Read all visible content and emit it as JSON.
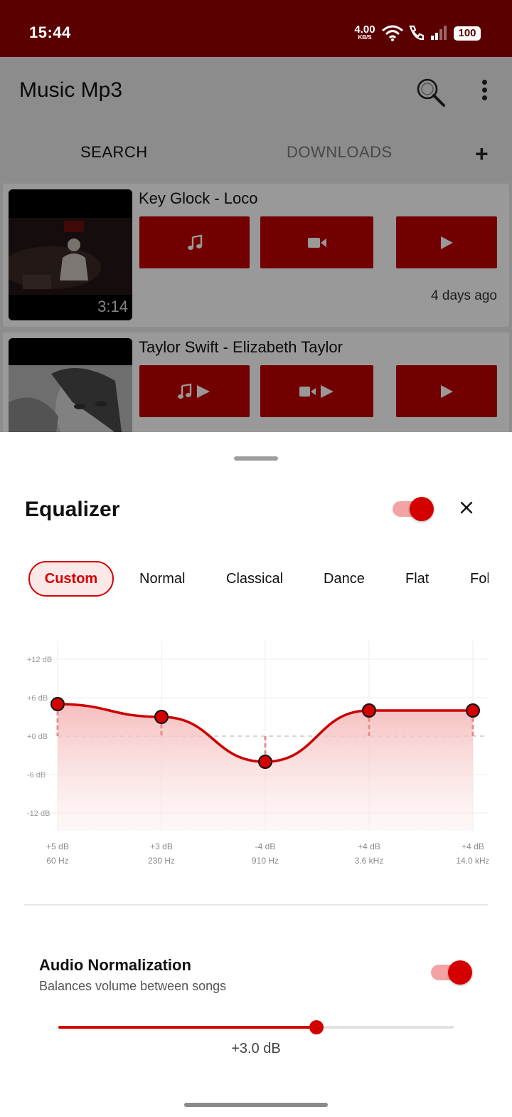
{
  "status_bar": {
    "time": "15:44",
    "net_speed": "4.00",
    "net_unit": "KB/S",
    "battery": "100"
  },
  "app_bar": {
    "title": "Music Mp3",
    "tabs": [
      {
        "label": "SEARCH",
        "selected": true
      },
      {
        "label": "DOWNLOADS",
        "selected": false
      }
    ]
  },
  "results": [
    {
      "title": "Key Glock - Loco",
      "duration": "3:14",
      "age": "4 days ago"
    },
    {
      "title": "Taylor Swift - Elizabeth Taylor",
      "duration": "",
      "age": ""
    }
  ],
  "equalizer": {
    "title": "Equalizer",
    "enabled": true,
    "presets": [
      "Custom",
      "Normal",
      "Classical",
      "Dance",
      "Flat",
      "Folk"
    ],
    "selected_preset": "Custom",
    "db_axis": [
      "+12 dB",
      "+6 dB",
      "+0 dB",
      "-6 dB",
      "-12 dB"
    ],
    "db_range": [
      -15,
      15
    ],
    "bands": [
      {
        "gain_label": "+5 dB",
        "freq": "60 Hz",
        "gain": 5
      },
      {
        "gain_label": "+3 dB",
        "freq": "230 Hz",
        "gain": 3
      },
      {
        "gain_label": "-4 dB",
        "freq": "910 Hz",
        "gain": -4
      },
      {
        "gain_label": "+4 dB",
        "freq": "3.6 kHz",
        "gain": 4
      },
      {
        "gain_label": "+4 dB",
        "freq": "14.0 kHz",
        "gain": 4
      }
    ]
  },
  "normalization": {
    "title": "Audio Normalization",
    "subtitle": "Balances volume between songs",
    "enabled": true,
    "value_label": "+3.0 dB",
    "fraction": 0.653
  },
  "colors": {
    "accent": "#d40000",
    "button_red": "#c00000",
    "status_bar": "#5a0000"
  }
}
